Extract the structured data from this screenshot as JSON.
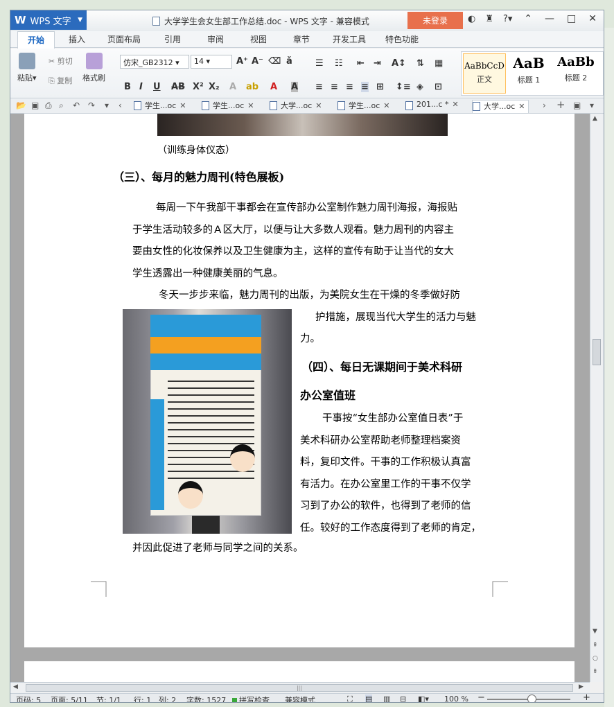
{
  "app": {
    "name": "WPS 文字",
    "document_title": "大学学生会女生部工作总结.doc - WPS 文字 - 兼容模式",
    "login_label": "未登录"
  },
  "ribbon_tabs": [
    "开始",
    "插入",
    "页面布局",
    "引用",
    "审阅",
    "视图",
    "章节",
    "开发工具",
    "特色功能"
  ],
  "ribbon": {
    "paste": "粘贴",
    "cut": "剪切",
    "copy": "复制",
    "format_painter": "格式刷",
    "font_name": "仿宋_GB2312",
    "font_size": "14",
    "styles": [
      {
        "preview": "AaBbCcD",
        "label": "正文"
      },
      {
        "preview": "AaB",
        "label": "标题 1"
      },
      {
        "preview": "AaBb",
        "label": "标题 2"
      }
    ]
  },
  "doc_tabs": [
    "学生...oc",
    "学生...oc",
    "大学...oc",
    "学生...oc",
    "201...c *",
    "大学...oc"
  ],
  "document": {
    "caption": "（训练身体仪态）",
    "heading3": "（三）、每月的魅力周刊(特色展板)",
    "para1": [
      "每周一下午我部干事都会在宣传部办公室制作魅力周刊海报，海报贴",
      "于学生活动较多的Ａ区大厅，以便与让大多数人观看。魅力周刊的内容主",
      "要由女性的化妆保养以及卫生健康为主，这样的宣传有助于让当代的女大",
      "学生透露出一种健康美丽的气息。"
    ],
    "para2_line1": "冬天一步步来临，魅力周刊的出版，为美院女生在干燥的冬季做好防",
    "para2_line2": "护措施，展现当代大学生的活力与魅",
    "para2_line3": "力。",
    "heading4_line1": "（四）、每日无课期间于美术科研",
    "heading4_line2": "办公室值班",
    "para3": [
      "干事按“女生部办公室值日表”于",
      "美术科研办公室帮助老师整理档案资",
      "料，复印文件。干事的工作积极认真富",
      "有活力。在办公室里工作的干事不仅学",
      "习到了办公的软件，也得到了老师的信",
      "任。较好的工作态度得到了老师的肯定，"
    ],
    "para3_last": "并因此促进了老师与同学之间的关系。"
  },
  "status": {
    "page": "页码: 5",
    "pages": "页面: 5/11",
    "section": "节: 1/1",
    "row": "行: 1",
    "col": "列: 2",
    "words": "字数: 1527",
    "spell": "拼写检查",
    "mode": "兼容模式",
    "zoom": "100 %"
  }
}
